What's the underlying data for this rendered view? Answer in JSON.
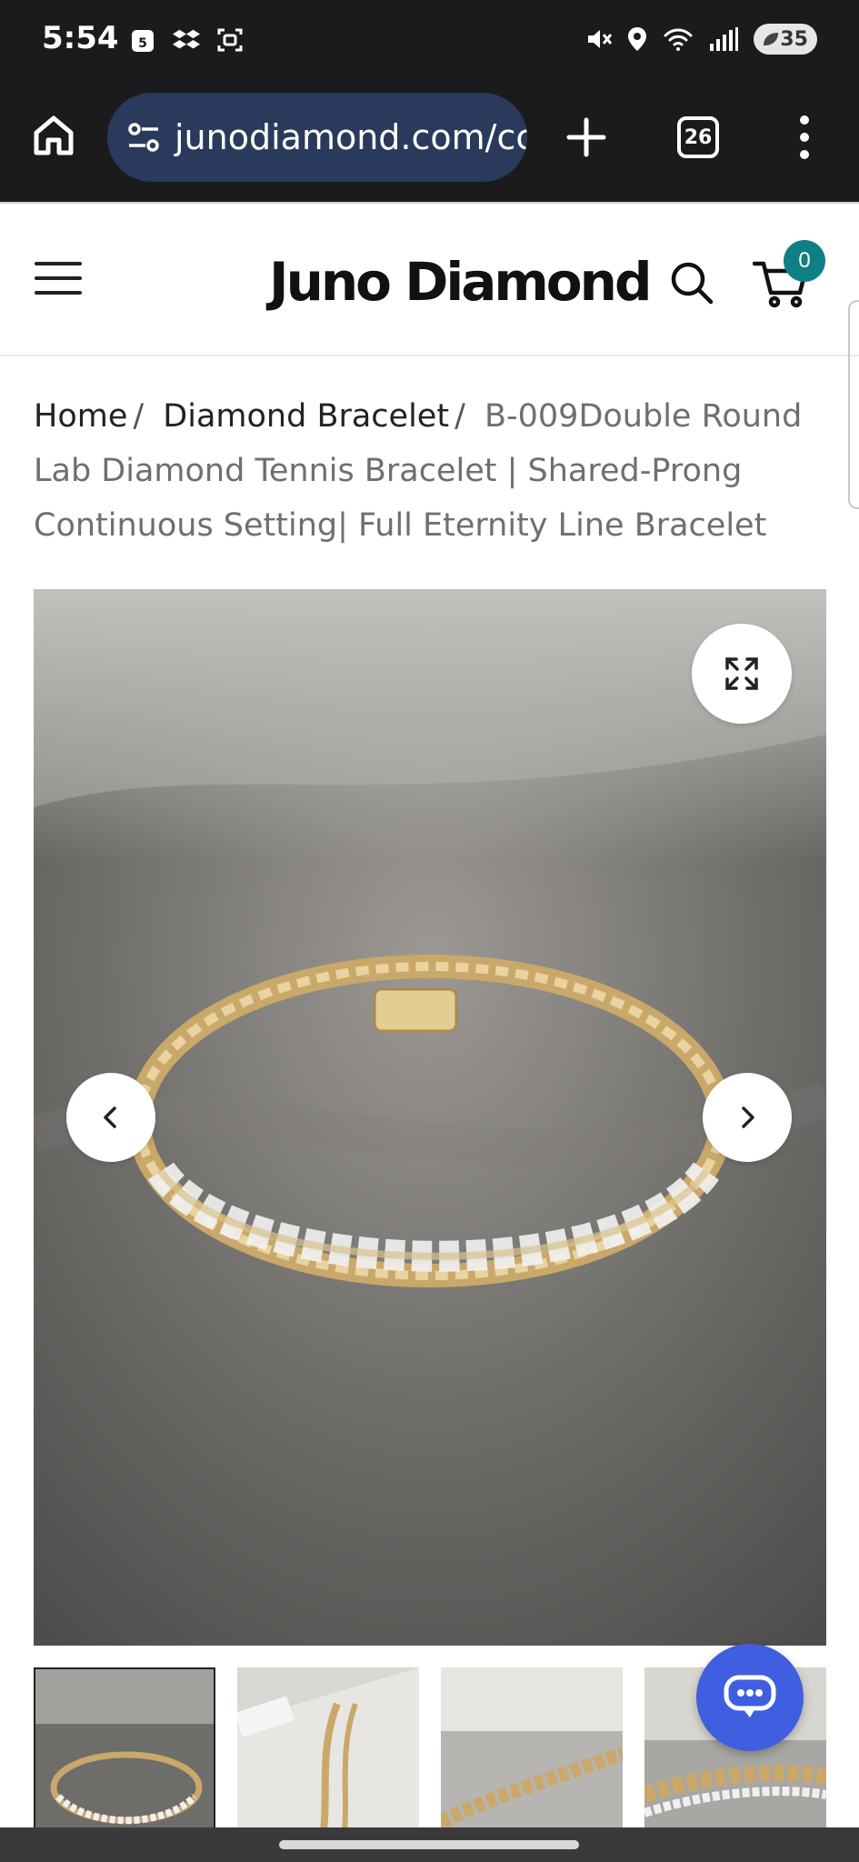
{
  "status_bar": {
    "time": "5:54",
    "calendar_day": "5",
    "battery_level": "35",
    "icons": [
      "calendar-icon",
      "dropbox-icon",
      "screenshot-icon",
      "mute-vibrate-icon",
      "location-icon",
      "wifi-icon",
      "signal-icon",
      "battery-icon"
    ]
  },
  "browser": {
    "url": "junodiamond.com/cc",
    "tab_count": "26",
    "icons": [
      "home-icon",
      "site-settings-icon",
      "new-tab-icon",
      "tab-switcher-icon",
      "more-vert-icon"
    ]
  },
  "header": {
    "brand": "Juno Diamond",
    "cart_count": "0",
    "icons": [
      "hamburger-menu-icon",
      "search-icon",
      "cart-icon"
    ]
  },
  "breadcrumb": {
    "items": [
      {
        "label": "Home"
      },
      {
        "label": "Diamond Bracelet"
      }
    ],
    "separator": "/",
    "current": "B-009Double Round Lab Diamond Tennis Bracelet | Shared-Prong Continuous Setting| Full Eternity Line Bracelet"
  },
  "gallery": {
    "icons": [
      "expand-icon",
      "chevron-left-icon",
      "chevron-right-icon"
    ],
    "thumbnail_count": 4,
    "active_thumbnail": 1
  },
  "chat": {
    "icon": "chat-bubble-icon",
    "color": "#3f5fe0"
  },
  "colors": {
    "browser_chrome": "#1b1b1d",
    "url_pill": "#2a3a5c",
    "cart_badge": "#0f7f86",
    "breadcrumb_current": "#6f6f6f"
  }
}
